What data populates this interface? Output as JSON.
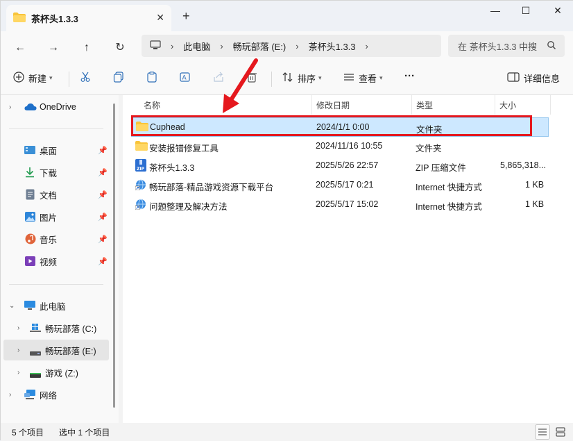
{
  "window": {
    "tab_title": "茶杯头1.3.3",
    "new_tab": "+",
    "minimize": "—",
    "maximize": "☐",
    "close": "✕"
  },
  "address": {
    "segments": [
      "此电脑",
      "畅玩部落 (E:)",
      "茶杯头1.3.3"
    ],
    "separator": "›",
    "search_placeholder": "在 茶杯头1.3.3 中搜"
  },
  "toolbar": {
    "new_label": "新建",
    "sort_label": "排序",
    "view_label": "查看",
    "more_label": "···",
    "details_label": "详细信息"
  },
  "sidebar": {
    "onedrive": "OneDrive",
    "quick": [
      {
        "label": "桌面",
        "icon": "desktop-icon"
      },
      {
        "label": "下载",
        "icon": "download-icon"
      },
      {
        "label": "文档",
        "icon": "document-icon"
      },
      {
        "label": "图片",
        "icon": "pictures-icon"
      },
      {
        "label": "音乐",
        "icon": "music-icon"
      },
      {
        "label": "视频",
        "icon": "video-icon"
      }
    ],
    "this_pc": "此电脑",
    "drives": [
      {
        "label": "畅玩部落 (C:)"
      },
      {
        "label": "畅玩部落 (E:)"
      },
      {
        "label": "游戏 (Z:)"
      }
    ],
    "network": "网络"
  },
  "columns": {
    "name": "名称",
    "modified": "修改日期",
    "type": "类型",
    "size": "大小"
  },
  "files": [
    {
      "name": "Cuphead",
      "modified": "2024/1/1 0:00",
      "type": "文件夹",
      "size": "",
      "icon": "folder-icon"
    },
    {
      "name": "安装报错修复工具",
      "modified": "2024/11/16 10:55",
      "type": "文件夹",
      "size": "",
      "icon": "folder-icon"
    },
    {
      "name": "茶杯头1.3.3",
      "modified": "2025/5/26 22:57",
      "type": "ZIP 压缩文件",
      "size": "5,865,318...",
      "icon": "zip-icon"
    },
    {
      "name": "畅玩部落-精品游戏资源下载平台",
      "modified": "2025/5/17 0:21",
      "type": "Internet 快捷方式",
      "size": "1 KB",
      "icon": "internet-shortcut-icon"
    },
    {
      "name": "问题整理及解决方法",
      "modified": "2025/5/17 15:02",
      "type": "Internet 快捷方式",
      "size": "1 KB",
      "icon": "internet-shortcut-icon"
    }
  ],
  "status": {
    "count": "5 个项目",
    "selected": "选中 1 个项目"
  },
  "colors": {
    "selection": "#cde8ff",
    "highlight_box": "#e5181e",
    "folder": "#f8c43a"
  }
}
